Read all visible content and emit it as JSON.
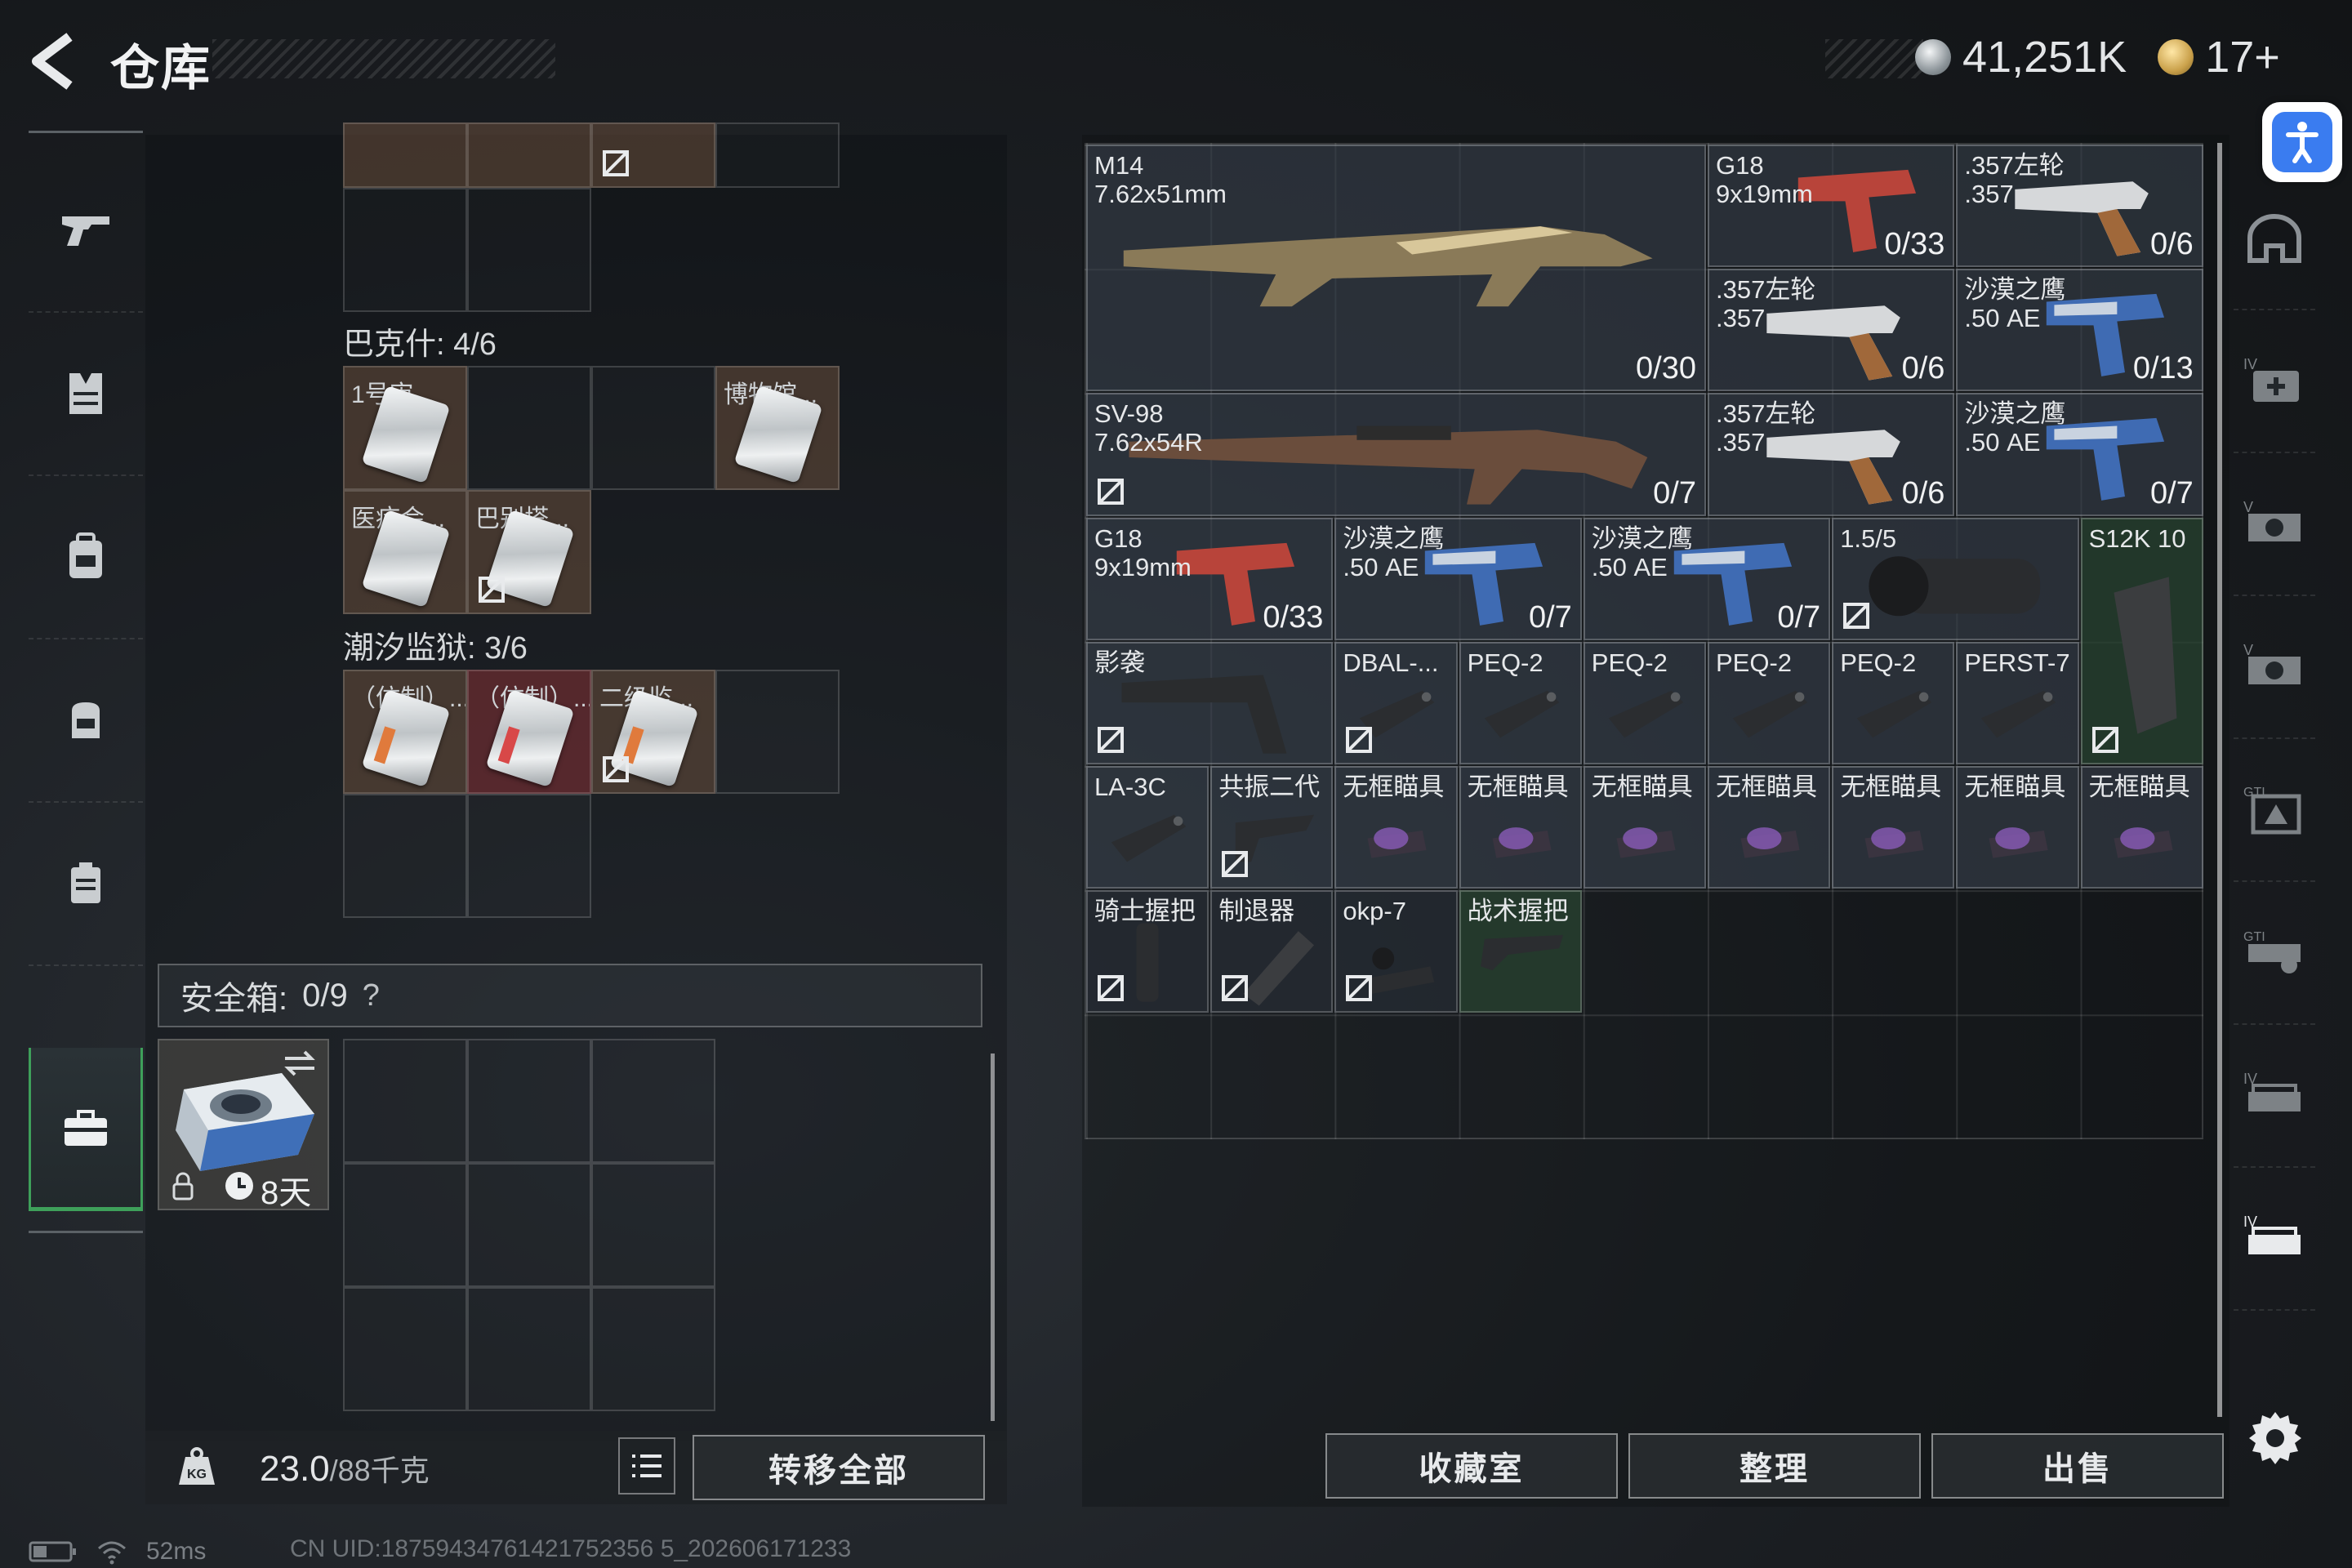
{
  "header": {
    "title": "仓库",
    "currency_primary": "41,251K",
    "currency_secondary": "17+"
  },
  "left_nav": {
    "items": [
      "weapon-icon",
      "armor-icon",
      "backpack-icon",
      "chest-rig-icon",
      "case-icon",
      "safe-box-icon"
    ],
    "active": "safe-box-icon"
  },
  "backpack": {
    "sections": [
      {
        "title": "巴克什: 4/6",
        "cards": [
          {
            "label": "1号审...",
            "bg": "brown"
          },
          {
            "label": "博物馆...",
            "bg": "brown"
          },
          {
            "label": "医疗会...",
            "bg": "brown"
          },
          {
            "label": "巴别塔...",
            "bg": "brown"
          }
        ]
      },
      {
        "title": "潮汐监狱: 3/6",
        "cards": [
          {
            "label": "（仿制）...",
            "bg": "brown"
          },
          {
            "label": "（仿制）...",
            "bg": "red"
          },
          {
            "label": "二级监...",
            "bg": "brown"
          }
        ]
      }
    ]
  },
  "safe_box": {
    "label": "安全箱:",
    "capacity": "0/9",
    "help": "?",
    "timer": "8天"
  },
  "weight": {
    "current": "23.0",
    "max": "/88千克"
  },
  "buttons": {
    "transfer_all": "转移全部",
    "collection": "收藏室",
    "organize": "整理",
    "sell": "出售"
  },
  "stash_items": [
    {
      "name": "M14\n7.62x51mm",
      "count": "0/30"
    },
    {
      "name": "G18\n9x19mm",
      "count": "0/33"
    },
    {
      "name": ".357左轮\n.357",
      "count": "0/6"
    },
    {
      "name": ".357左轮\n.357",
      "count": "0/6"
    },
    {
      "name": "沙漠之鹰\n.50 AE",
      "count": "0/13"
    },
    {
      "name": "SV-98\n7.62x54R",
      "count": "0/7"
    },
    {
      "name": ".357左轮\n.357",
      "count": "0/6"
    },
    {
      "name": "沙漠之鹰\n.50 AE",
      "count": "0/7"
    },
    {
      "name": "G18\n9x19mm",
      "count": "0/33"
    },
    {
      "name": "沙漠之鹰\n.50 AE",
      "count": "0/7"
    },
    {
      "name": "沙漠之鹰\n.50 AE",
      "count": "0/7"
    },
    {
      "name": "1.5/5",
      "count": ""
    },
    {
      "name": "S12K 10",
      "count": ""
    },
    {
      "name": "影袭",
      "count": ""
    },
    {
      "name": "DBAL-...",
      "count": ""
    },
    {
      "name": "PEQ-2",
      "count": ""
    },
    {
      "name": "PEQ-2",
      "count": ""
    },
    {
      "name": "PEQ-2",
      "count": ""
    },
    {
      "name": "PEQ-2",
      "count": ""
    },
    {
      "name": "PERST-7",
      "count": ""
    },
    {
      "name": "LA-3C",
      "count": ""
    },
    {
      "name": "共振二代",
      "count": ""
    },
    {
      "name": "无框瞄具",
      "count": ""
    },
    {
      "name": "无框瞄具",
      "count": ""
    },
    {
      "name": "无框瞄具",
      "count": ""
    },
    {
      "name": "无框瞄具",
      "count": ""
    },
    {
      "name": "无框瞄具",
      "count": ""
    },
    {
      "name": "无框瞄具",
      "count": ""
    },
    {
      "name": "无框瞄具",
      "count": ""
    },
    {
      "name": "骑士握把",
      "count": ""
    },
    {
      "name": "制退器",
      "count": ""
    },
    {
      "name": "okp-7",
      "count": ""
    },
    {
      "name": "战术握把",
      "count": ""
    }
  ],
  "status": {
    "ping": "52ms",
    "uid": "CN UID:18759434761421752356 5_202606171233"
  },
  "colors": {
    "accent_green": "#3ea05a",
    "cell_brown": "#694e3c",
    "cell_red": "#7d2e34",
    "accessibility_blue": "#3a7cf0"
  }
}
